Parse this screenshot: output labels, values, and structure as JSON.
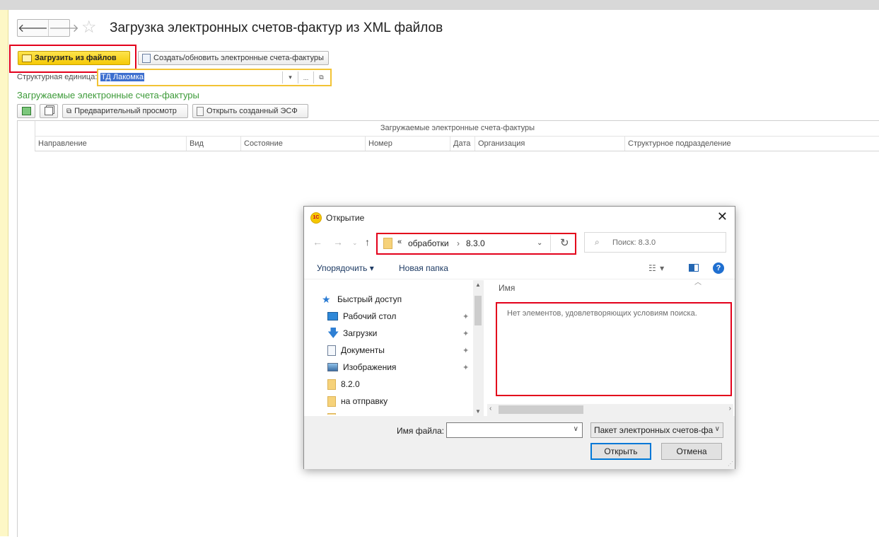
{
  "header": {
    "back_icon": "arrow-left",
    "forward_icon": "arrow-right",
    "favorite_icon": "star",
    "title": "Загрузка электронных счетов-фактур из XML файлов"
  },
  "toolbar": {
    "load_label": "Загрузить из файлов",
    "create_label": "Создать/обновить электронные счета-фактуры"
  },
  "unit": {
    "label": "Структурная единица:",
    "value": "ТД Лакомка",
    "dropdown_symbol": "▾",
    "select_symbol": "...",
    "open_symbol": "⧉"
  },
  "section": {
    "title": "Загружаемые электронные счета-фактуры",
    "preview_label": "Предварительный просмотр",
    "open_esf_label": "Открыть созданный ЭСФ"
  },
  "table": {
    "group_header": "Загружаемые электронные счета-фактуры",
    "columns": [
      "Направление",
      "Вид",
      "Состояние",
      "Номер",
      "Дата",
      "Организация",
      "Структурное подразделение"
    ]
  },
  "dialog": {
    "title": "Открытие",
    "logo_text": "1С",
    "path": [
      "«",
      "обработки",
      "›",
      "8.3.0"
    ],
    "search_placeholder": "Поиск: 8.3.0",
    "organize_label": "Упорядочить ▾",
    "new_folder_label": "Новая папка",
    "help_symbol": "?",
    "tree": [
      {
        "label": "Быстрый доступ",
        "icon": "star-icon",
        "pinned": false
      },
      {
        "label": "Рабочий стол",
        "icon": "desktop-icon",
        "pinned": true
      },
      {
        "label": "Загрузки",
        "icon": "download-icon",
        "pinned": true
      },
      {
        "label": "Документы",
        "icon": "document-icon",
        "pinned": true
      },
      {
        "label": "Изображения",
        "icon": "image-icon",
        "pinned": true
      },
      {
        "label": "8.2.0",
        "icon": "folder-icon",
        "pinned": false
      },
      {
        "label": "на отправку",
        "icon": "folder-icon",
        "pinned": false
      }
    ],
    "column_name": "Имя",
    "empty_message": "Нет элементов, удовлетворяющих условиям поиска.",
    "filename_label": "Имя файла:",
    "filename_value": "",
    "filter_value": "Пакет электронных счетов-фа",
    "open_label": "Открыть",
    "cancel_label": "Отмена"
  },
  "colors": {
    "highlight_red": "#e3001b",
    "accent_yellow": "#f5c905",
    "section_green": "#3c9a38",
    "windows_blue": "#0078d7"
  }
}
